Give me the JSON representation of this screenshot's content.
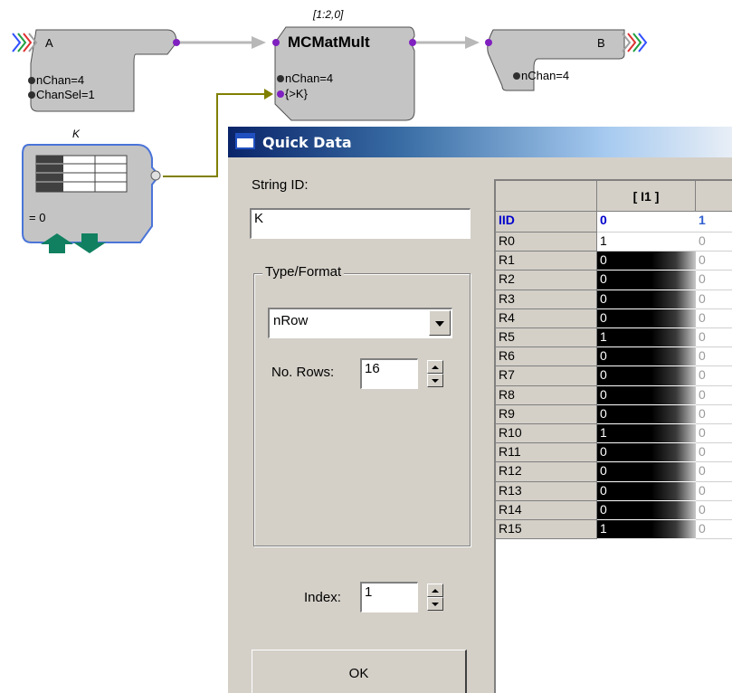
{
  "circuit": {
    "block_a": {
      "name": "A",
      "params": [
        "nChan=4",
        "ChanSel=1"
      ]
    },
    "block_mult": {
      "index_label": "[1:2,0]",
      "name": "MCMatMult",
      "params": [
        "nChan=4",
        "{>K}"
      ]
    },
    "block_b": {
      "name": "B",
      "params": [
        "nChan=4"
      ]
    },
    "block_k": {
      "name": "K",
      "value": "= 0"
    },
    "colors": {
      "block_fill": "#c8c8c8",
      "wire_grey": "#b8b8b8",
      "wire_olive": "#808000",
      "port_purple": "#8020c0",
      "k_border": "#4a74d8",
      "k_arrows": "#108060"
    }
  },
  "dialog": {
    "title": "Quick Data",
    "string_id_label": "String ID:",
    "string_id_value": "K",
    "type_format_label": "Type/Format",
    "format_selected": "nRow",
    "no_rows_label": "No. Rows:",
    "no_rows_value": "16",
    "index_label": "Index:",
    "index_value": "1",
    "ok_label": "OK"
  },
  "grid": {
    "col_header": "[ I1 ]",
    "iid_label": "IID",
    "iid_values": [
      "0",
      "1"
    ],
    "rows": [
      {
        "label": "R0",
        "v1": "1",
        "v2": "0"
      },
      {
        "label": "R1",
        "v1": "0",
        "v2": "0"
      },
      {
        "label": "R2",
        "v1": "0",
        "v2": "0"
      },
      {
        "label": "R3",
        "v1": "0",
        "v2": "0"
      },
      {
        "label": "R4",
        "v1": "0",
        "v2": "0"
      },
      {
        "label": "R5",
        "v1": "1",
        "v2": "0"
      },
      {
        "label": "R6",
        "v1": "0",
        "v2": "0"
      },
      {
        "label": "R7",
        "v1": "0",
        "v2": "0"
      },
      {
        "label": "R8",
        "v1": "0",
        "v2": "0"
      },
      {
        "label": "R9",
        "v1": "0",
        "v2": "0"
      },
      {
        "label": "R10",
        "v1": "1",
        "v2": "0"
      },
      {
        "label": "R11",
        "v1": "0",
        "v2": "0"
      },
      {
        "label": "R12",
        "v1": "0",
        "v2": "0"
      },
      {
        "label": "R13",
        "v1": "0",
        "v2": "0"
      },
      {
        "label": "R14",
        "v1": "0",
        "v2": "0"
      },
      {
        "label": "R15",
        "v1": "1",
        "v2": "0"
      }
    ]
  }
}
